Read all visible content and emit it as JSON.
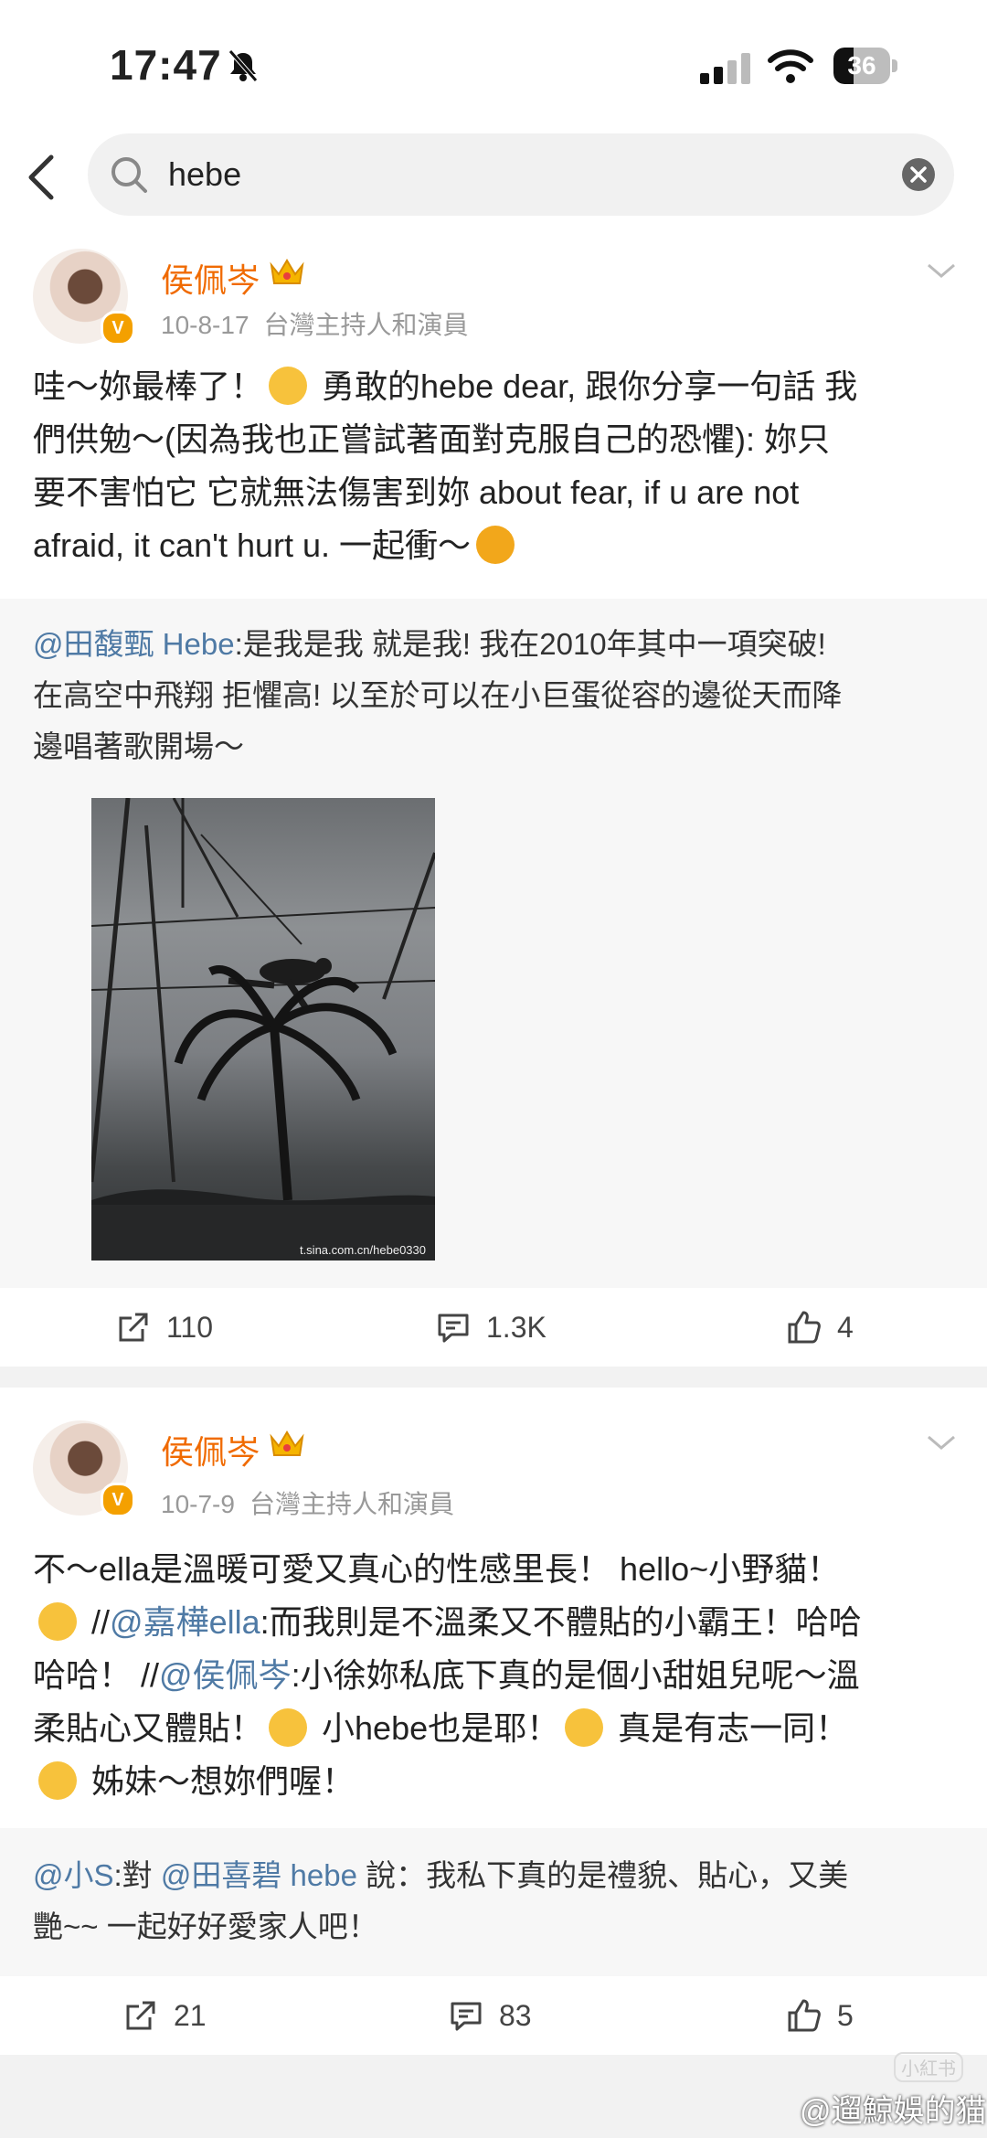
{
  "status": {
    "time": "17:47",
    "battery_level": "36"
  },
  "search": {
    "query": "hebe"
  },
  "posts": [
    {
      "author": "侯佩岑",
      "date": "10-8-17",
      "source": "台灣主持人和演員",
      "text": {
        "l1a": "哇～妳最棒了！",
        "l1b": "勇敢的hebe dear, 跟你分享一句話 我",
        "l2": "們供勉～(因為我也正嘗試著面對克服自己的恐懼): 妳只",
        "l3": "要不害怕它 它就無法傷害到妳 about fear, if u are not",
        "l4": "afraid, it can't hurt u. 一起衝～"
      },
      "repost": {
        "mention": "@田馥甄 Hebe",
        "l1": ":是我是我 就是我! 我在2010年其中一項突破!",
        "l2": "在高空中飛翔 拒懼高! 以至於可以在小巨蛋從容的邊從天而降",
        "l3": "邊唱著歌開場～",
        "image_watermark": "t.sina.com.cn/hebe0330"
      },
      "actions": {
        "reposts": "110",
        "comments": "1.3K",
        "likes": "4"
      }
    },
    {
      "author": "侯佩岑",
      "date": "10-7-9",
      "source": "台灣主持人和演員",
      "text": {
        "l1": "不～ella是溫暖可愛又真心的性感里長！ hello~小野貓！",
        "l2a": "//",
        "l2m": "@嘉樺ella",
        "l2b": ":而我則是不溫柔又不體貼的小霸王！哈哈",
        "l3a": "哈哈！  //",
        "l3m": "@侯佩岑",
        "l3b": ":小徐妳私底下真的是個小甜姐兒呢～溫",
        "l4a": "柔貼心又體貼！",
        "l4b": "小hebe也是耶！",
        "l4c": "真是有志一同！",
        "l5": "姊妹～想妳們喔！"
      },
      "repost": {
        "m1": "@小S",
        "t1": ":對 ",
        "m2": "@田喜碧 hebe",
        "t2": " 說：我私下真的是禮貌、貼心，又美",
        "l2": "艷~~ 一起好好愛家人吧！"
      },
      "actions": {
        "reposts": "21",
        "comments": "83",
        "likes": "5"
      }
    }
  ],
  "footer": {
    "watermark": "@遛鯨娛的猫",
    "badge": "小紅书"
  }
}
